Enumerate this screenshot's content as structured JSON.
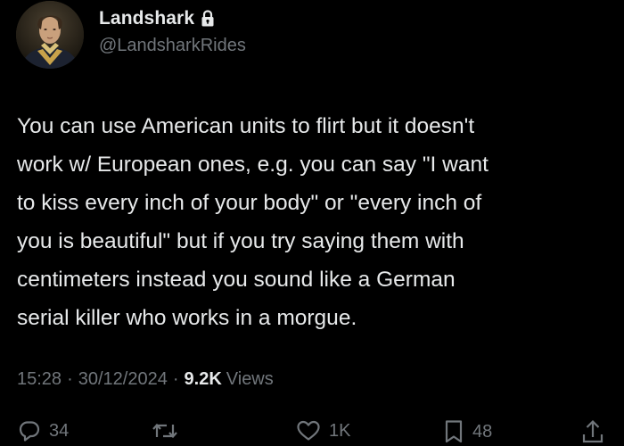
{
  "author": {
    "display_name": "Landshark",
    "handle": "@LandsharkRides",
    "protected": true,
    "avatar_icon": "portrait-avatar"
  },
  "tweet": {
    "text": "You can use American units to flirt but it doesn't\nwork w/ European ones, e.g. you can say \"I want\nto kiss every inch of your body\" or \"every inch of\nyou is beautiful\" but if you try saying them with\ncentimeters instead you sound like a German\nserial killer who works in a morgue."
  },
  "meta": {
    "time": "15:28",
    "separator": "·",
    "date": "30/12/2024",
    "views_count": "9.2K",
    "views_label": "Views"
  },
  "actions": {
    "replies": "34",
    "reposts": "",
    "likes": "1K",
    "bookmarks": "48"
  },
  "colors": {
    "background": "#000000",
    "primary_text": "#e7e9ea",
    "secondary_text": "#71767b"
  }
}
